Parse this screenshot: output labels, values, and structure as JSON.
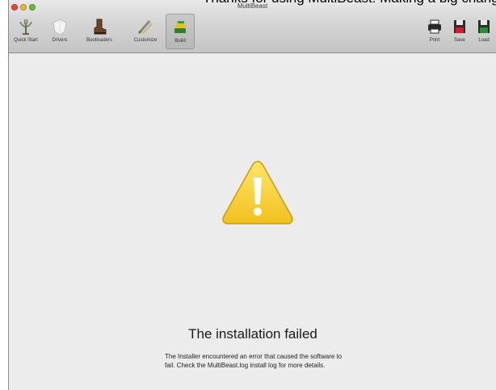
{
  "window": {
    "title": "MultiBeast"
  },
  "overlap_text": "Thanks for using MultiBeast! Making a big change to your system? Remember to make a backup first. Installing things ontoyourbasesystemis not",
  "toolbar": {
    "left": [
      {
        "id": "quick-start",
        "label": "Quick Start",
        "icon": "quick-start-icon"
      },
      {
        "id": "drivers",
        "label": "Drivers",
        "icon": "drivers-icon"
      },
      {
        "id": "bootloaders",
        "label": "Bootloaders",
        "icon": "bootloaders-icon"
      },
      {
        "id": "customize",
        "label": "Customize",
        "icon": "customize-icon"
      },
      {
        "id": "build",
        "label": "Build",
        "icon": "build-icon",
        "selected": true
      }
    ],
    "right": [
      {
        "id": "print",
        "label": "Print",
        "icon": "printer-icon"
      },
      {
        "id": "save",
        "label": "Save",
        "icon": "save-icon"
      },
      {
        "id": "load",
        "label": "Load",
        "icon": "load-icon"
      }
    ]
  },
  "main": {
    "icon": "warning-icon",
    "title": "The installation failed",
    "description": "The Installer encountered an error that caused the software to fail. Check the MultiBeast.log install log for more details."
  },
  "colors": {
    "warning": "#f7d33a",
    "window_bg": "#ececec"
  }
}
